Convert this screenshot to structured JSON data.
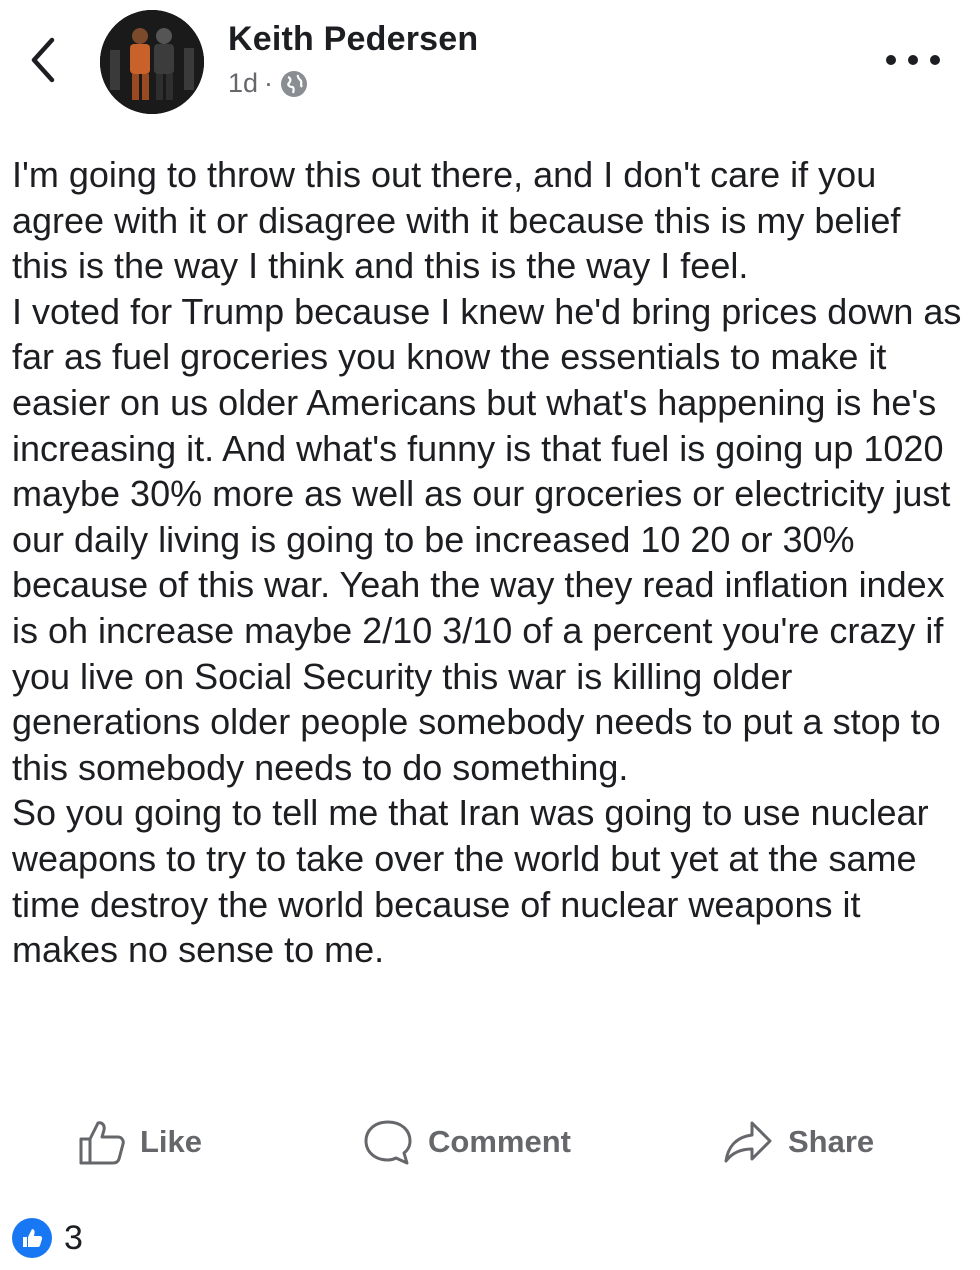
{
  "post": {
    "author": "Keith Pedersen",
    "time": "1d",
    "separator": "·",
    "body": [
      "I'm going to throw this out there, and I don't care if you agree with it or disagree with it because this is my belief this is the way I think and this is the way I feel.",
      "I voted for Trump because I knew he'd bring prices down as far as fuel groceries you know the essentials to make it easier on us older Americans but what's happening is he's increasing it. And what's funny is that fuel is going up 1020 maybe 30% more as well as our groceries or electricity just our daily living is going to be increased 10 20 or 30% because of this war. Yeah the way they read inflation index is oh increase maybe 2/10 3/10 of a percent you're crazy if you live on Social Security this war is killing older generations older people somebody needs to put a stop to this somebody needs to do something.",
      "So you going to tell me that Iran was going to use nuclear weapons to try to take over the world but yet at the same time destroy the world because of nuclear weapons it makes no sense to me."
    ]
  },
  "actions": {
    "like": "Like",
    "comment": "Comment",
    "share": "Share"
  },
  "reactions": {
    "count": "3"
  },
  "icons": {
    "back": "chevron-left-icon",
    "more": "more-horizontal-icon",
    "privacy": "globe-icon",
    "like": "thumbs-up-icon",
    "comment": "comment-bubble-icon",
    "share": "share-arrow-icon",
    "reaction": "like-reaction-icon"
  },
  "colors": {
    "text": "#1c1e21",
    "muted": "#65676b",
    "like_blue": "#1877f2"
  }
}
